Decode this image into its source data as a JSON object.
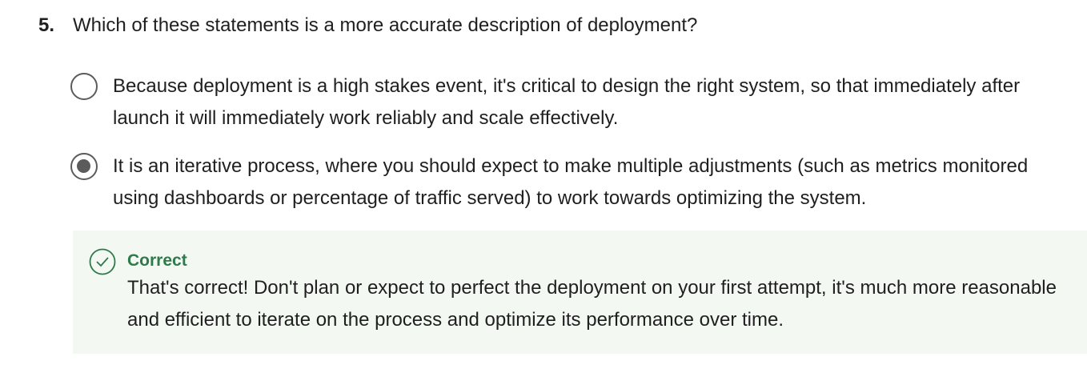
{
  "question": {
    "number": "5.",
    "text": "Which of these statements is a more accurate description of deployment?"
  },
  "options": [
    {
      "label": "Because deployment is a high stakes event, it's critical to design the right system, so that immediately after launch it will immediately work reliably and scale effectively.",
      "selected": false
    },
    {
      "label": "It is an iterative process, where you should expect to make multiple adjustments (such as metrics monitored using dashboards or percentage of traffic served) to work towards optimizing the system.",
      "selected": true
    }
  ],
  "feedback": {
    "status": "Correct",
    "icon": "check-circle-icon",
    "message": "That's correct! Don't plan or expect to perfect the deployment on your first attempt, it's much more reasonable and efficient to iterate on the process and optimize its performance over time.",
    "color": "#2f7a4b",
    "background": "#f3f8f3"
  }
}
